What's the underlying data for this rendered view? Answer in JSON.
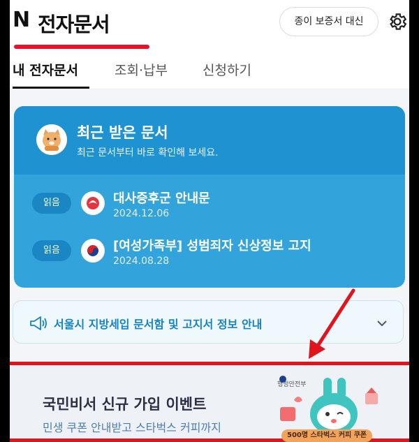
{
  "header": {
    "logo": "N",
    "title": "전자문서",
    "paper_guarantee_button": "종이 보증서 대신"
  },
  "tabs": [
    {
      "label": "내 전자문서",
      "active": true
    },
    {
      "label": "조회·납부",
      "active": false
    },
    {
      "label": "신청하기",
      "active": false
    }
  ],
  "recent_card": {
    "title": "최근 받은 문서",
    "subtitle": "최근 문서부터 바로 확인해 보세요.",
    "documents": [
      {
        "badge": "읽음",
        "title": "대사증후군 안내문",
        "date": "2024.12.06",
        "icon": "health-insurance-icon"
      },
      {
        "badge": "읽음",
        "title": "[여성가족부] 성범죄자 신상정보 고지",
        "date": "2024.08.28",
        "icon": "korea-government-emblem-icon"
      }
    ]
  },
  "notice": {
    "text": "서울시 지방세입 문서함 및 고지서 정보 안내",
    "icon": "megaphone-icon"
  },
  "banner": {
    "title": "국민비서 신규 가입 이벤트",
    "subtitle": "민생 쿠폰 안내받고 스타벅스 커피까지",
    "ministry": "행정안전부",
    "coupon": "500명 스타벅스 커피 쿠폰"
  },
  "colors": {
    "accent_red": "#e8132b",
    "card_blue": "#33a3db",
    "card_blue_dark": "#1f93d2",
    "notice_blue": "#1683c2"
  }
}
